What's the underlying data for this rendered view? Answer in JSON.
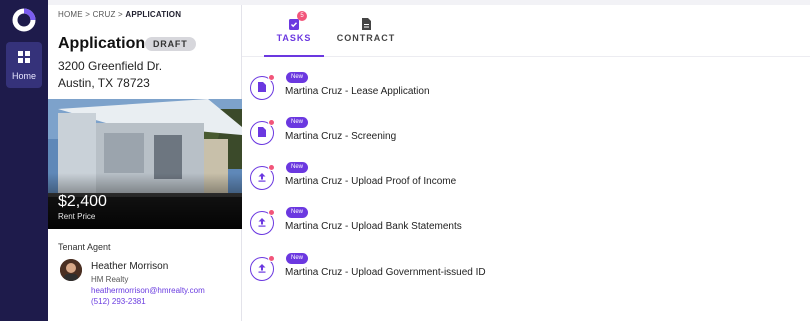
{
  "colors": {
    "rail": "#1e1b4b",
    "accent": "#6b38e0",
    "alert": "#f2557a",
    "link": "#6a3ce0"
  },
  "nav": {
    "logo_icon": "ring-logo-icon",
    "items": [
      {
        "label": "Home",
        "icon": "grid-icon"
      }
    ]
  },
  "breadcrumb": {
    "home": "HOME",
    "sep": ">",
    "cruz": "CRUZ",
    "current": "APPLICATION"
  },
  "application": {
    "title": "Application",
    "status": "DRAFT",
    "address_line1": "3200 Greenfield Dr.",
    "address_line2": "Austin, TX 78723",
    "price": "$2,400",
    "price_label": "Rent Price"
  },
  "agent": {
    "heading": "Tenant Agent",
    "name": "Heather Morrison",
    "company": "HM Realty",
    "email": "heathermorrison@hmrealty.com",
    "phone": "(512) 293-2381"
  },
  "tabs": [
    {
      "label": "TASKS",
      "icon": "clipboard-check-icon",
      "badge": "5",
      "active": true
    },
    {
      "label": "CONTRACT",
      "icon": "document-icon",
      "active": false
    }
  ],
  "tasks": [
    {
      "badge": "New",
      "name": "Martina Cruz - Lease Application",
      "icon": "document-icon"
    },
    {
      "badge": "New",
      "name": "Martina Cruz - Screening",
      "icon": "document-icon"
    },
    {
      "badge": "New",
      "name": "Martina Cruz - Upload Proof of Income",
      "icon": "upload-icon"
    },
    {
      "badge": "New",
      "name": "Martina Cruz - Upload Bank Statements",
      "icon": "upload-icon"
    },
    {
      "badge": "New",
      "name": "Martina Cruz - Upload Government-issued ID",
      "icon": "upload-icon"
    }
  ]
}
